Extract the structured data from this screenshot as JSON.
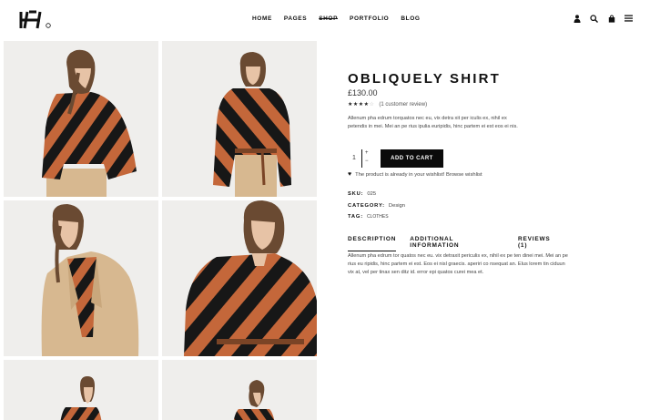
{
  "header": {
    "logo_alt": "logo",
    "nav": [
      "HOME",
      "PAGES",
      "SHOP",
      "PORTFOLIO",
      "BLOG"
    ],
    "icons": [
      "user-icon",
      "search-icon",
      "cart-icon",
      "menu-icon"
    ]
  },
  "gallery": {
    "images": [
      "model-back-view",
      "model-side-view",
      "model-coat-view",
      "model-front-view",
      "model-lower-left",
      "model-lower-right"
    ]
  },
  "product": {
    "title": "OBLIQUELY SHIRT",
    "price": "£130.00",
    "rating_stars": 4,
    "rating_max": 5,
    "review_text": "(1 customer review)",
    "description": "Allenum pha edrum torquatos nec eu, vix detra xit per iculis ex, nihil ex petendis in mei. Mei an pe rius ipulia euripidis, hinc partem ei est eos ei nis.",
    "quantity": "1",
    "qty_plus": "+",
    "qty_minus": "−",
    "add_to_cart": "ADD TO CART",
    "wishlist_text": "The product is already in your wishlist! Browse wishlist",
    "sku_label": "SKU:",
    "sku_value": "025",
    "category_label": "CATEGORY:",
    "category_value": "Design",
    "tag_label": "TAG:",
    "tag_value": "CLOTHES",
    "tabs": [
      "DESCRIPTION",
      "ADDITIONAL INFORMATION",
      "REVIEWS (1)"
    ],
    "tab_content": "Allenum pha edrum tor quatos nec eu. vix detraxit periculis ex, nihil ex pe ten dinei mei. Mei an pe rius eu ripidis, hinc partem ei est. Eos ei nisl graecis. aperiri co nsequat an. Elus lorem tin ciduun vix at, vel per tinax sen ditz id. error epi quatos curei mea et."
  },
  "colors": {
    "orange": "#c4673a",
    "black": "#171717",
    "camel": "#d7b890",
    "skin": "#e7c3a6",
    "hair": "#6a4a32",
    "bg": "#efeeec"
  }
}
